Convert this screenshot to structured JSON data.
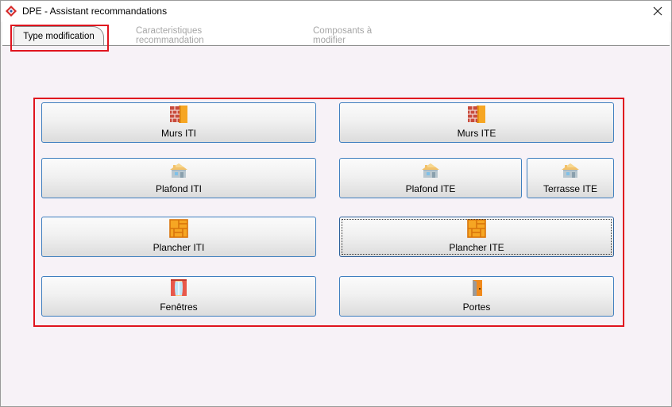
{
  "window": {
    "title": "DPE - Assistant recommandations",
    "close_glyph": "✕"
  },
  "tabs": [
    {
      "label": "Type modification",
      "active": true
    },
    {
      "label": "Caracteristiques recommandation",
      "active": false
    },
    {
      "label": "Composants à modifier",
      "active": false
    }
  ],
  "buttons": {
    "murs_iti": {
      "label": "Murs ITI",
      "icon": "brick-wall-icon"
    },
    "murs_ite": {
      "label": "Murs ITE",
      "icon": "brick-wall-icon"
    },
    "plafond_iti": {
      "label": "Plafond ITI",
      "icon": "house-icon"
    },
    "plafond_ite": {
      "label": "Plafond ITE",
      "icon": "house-icon"
    },
    "terrasse_ite": {
      "label": "Terrasse ITE",
      "icon": "house-icon"
    },
    "plancher_iti": {
      "label": "Plancher ITI",
      "icon": "parquet-floor-icon"
    },
    "plancher_ite": {
      "label": "Plancher ITE",
      "icon": "parquet-floor-icon"
    },
    "fenetres": {
      "label": "Fenêtres",
      "icon": "window-curtains-icon"
    },
    "portes": {
      "label": "Portes",
      "icon": "door-icon"
    }
  },
  "colors": {
    "highlight": "#e0141e",
    "button_border": "#3f7fbf",
    "panel_bg": "#f7f2f7"
  }
}
